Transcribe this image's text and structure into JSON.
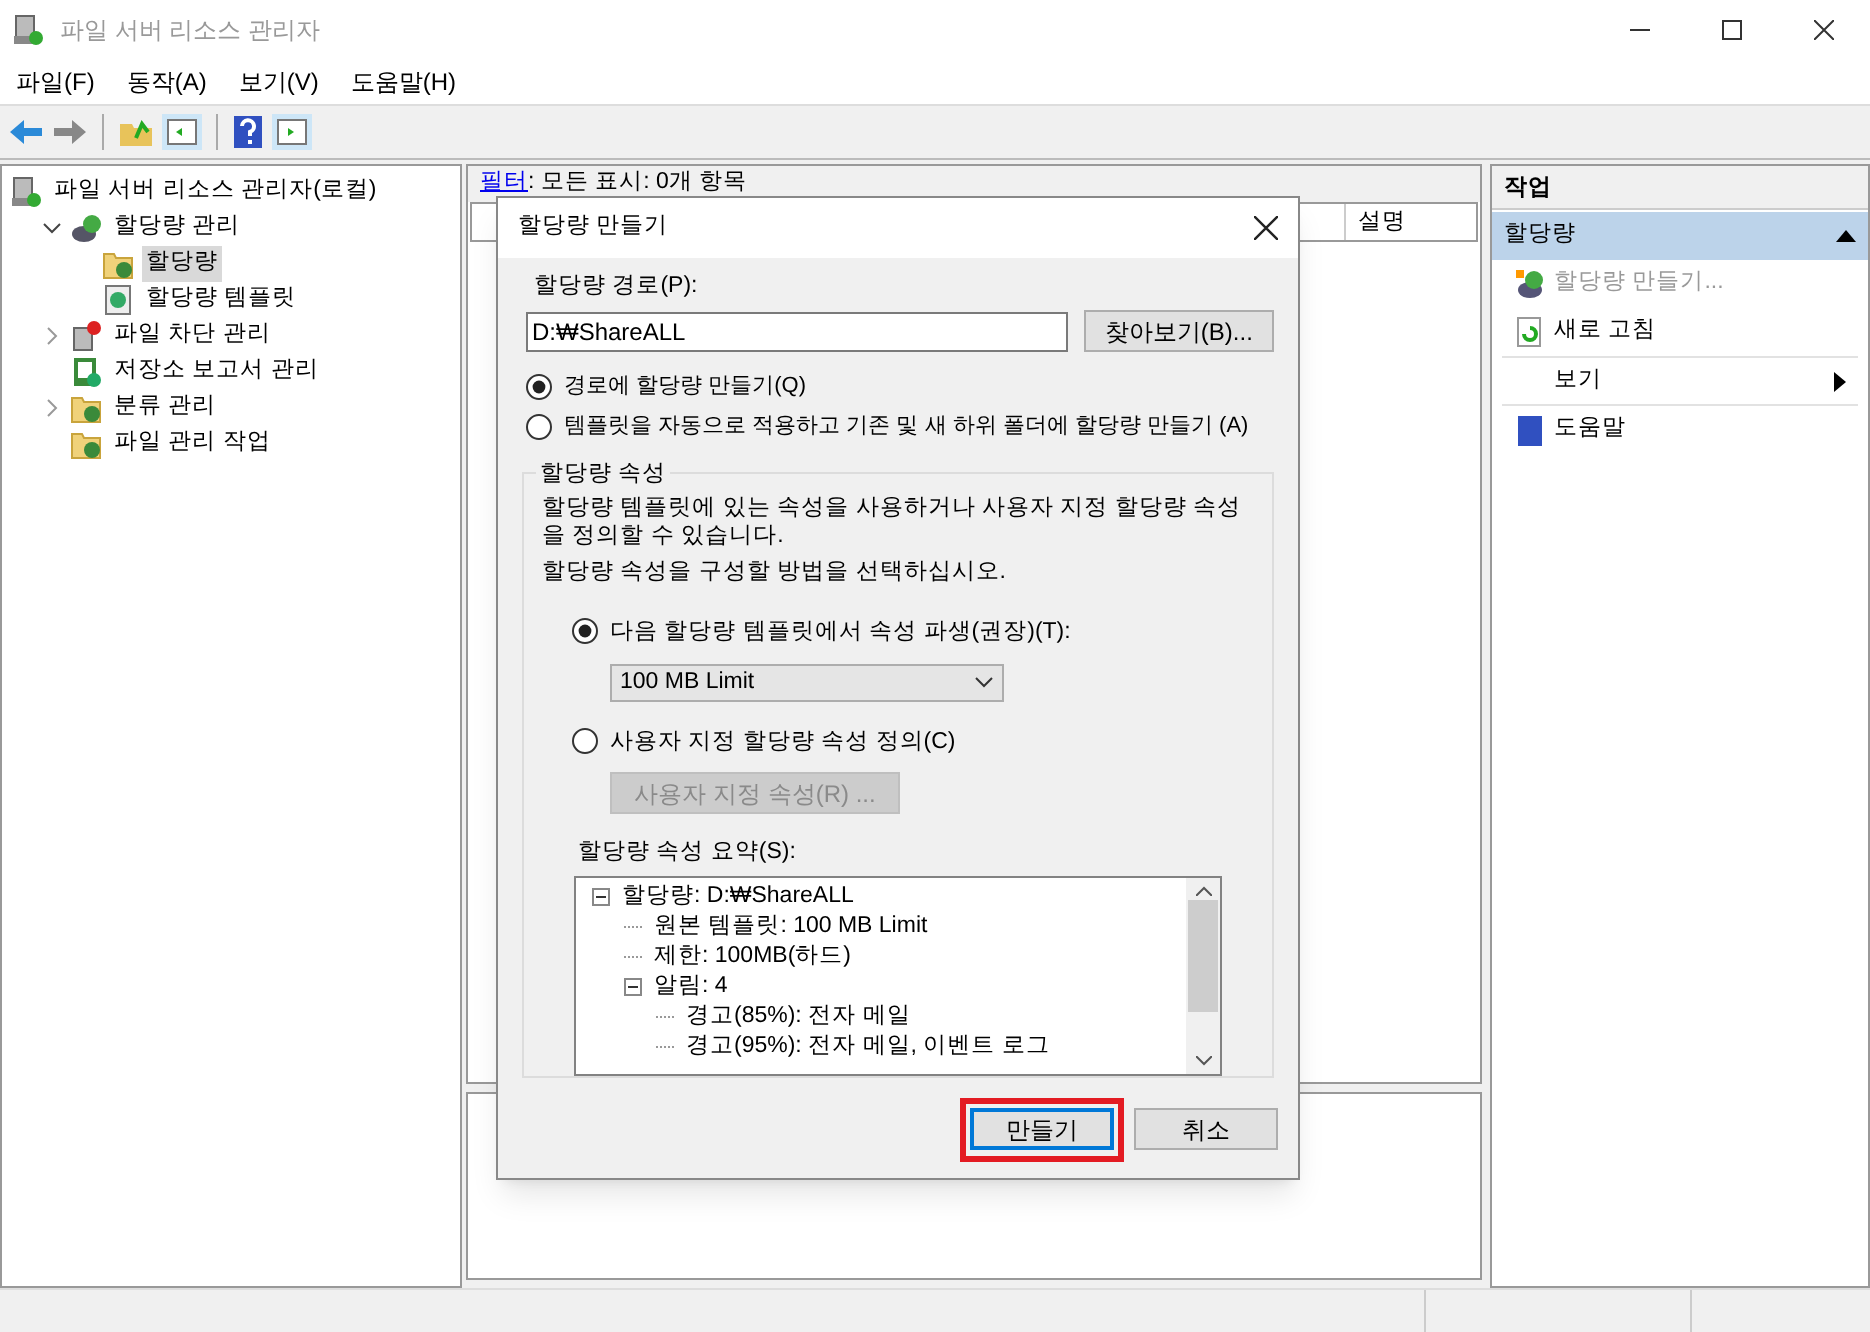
{
  "window": {
    "title": "파일 서버 리소스 관리자"
  },
  "menu": [
    "파일(F)",
    "동작(A)",
    "보기(V)",
    "도움말(H)"
  ],
  "tree": [
    {
      "label": "파일 서버 리소스 관리자(로컬)",
      "selected": false,
      "children": [
        {
          "label": "할당량 관리",
          "expanded": true,
          "selected": false,
          "children": [
            {
              "label": "할당량",
              "selected": true
            },
            {
              "label": "할당량 템플릿",
              "selected": false
            }
          ]
        },
        {
          "label": "파일 차단 관리",
          "expanded": false,
          "selected": false
        },
        {
          "label": "저장소 보고서 관리",
          "selected": false
        },
        {
          "label": "분류 관리",
          "expanded": false,
          "selected": false
        },
        {
          "label": "파일 관리 작업",
          "selected": false
        }
      ]
    }
  ],
  "center": {
    "filter_link": "필터",
    "filter_text": ": 모든 표시: 0개 항목",
    "columns": [
      "설명"
    ]
  },
  "actions": {
    "header": "작업",
    "section": "할당량",
    "items": [
      {
        "label": "할당량 만들기...",
        "kind": "action",
        "disabled": true
      },
      {
        "label": "새로 고침",
        "kind": "action",
        "disabled": false
      },
      {
        "label": "보기",
        "kind": "submenu",
        "disabled": false
      },
      {
        "label": "도움말",
        "kind": "action",
        "disabled": false
      }
    ]
  },
  "dialog": {
    "title": "할당량 만들기",
    "path_label": "할당량 경로(P):",
    "path_value": "D:₩ShareALL",
    "browse_button": "찾아보기(B)...",
    "modes": [
      {
        "label": "경로에 할당량 만들기(Q)",
        "selected": true
      },
      {
        "label": "템플릿을 자동으로 적용하고 기존 및 새 하위 폴더에 할당량 만들기 (A)",
        "selected": false
      }
    ],
    "group": {
      "title": "할당량 속성",
      "description": "할당량 템플릿에 있는 속성을 사용하거나 사용자 지정 할당량 속성을 정의할 수 있습니다.",
      "instruction": "할당량 속성을 구성할 방법을 선택하십시오.",
      "options": [
        {
          "label": "다음 할당량 템플릿에서 속성 파생(권장)(T):",
          "selected": true,
          "kind": "select",
          "value": "100 MB Limit"
        },
        {
          "label": "사용자 지정 할당량 속성 정의(C)",
          "selected": false,
          "kind": "button",
          "button": "사용자 지정 속성(R) ...",
          "disabled": true
        }
      ],
      "summary_label": "할당량 속성 요약(S):",
      "summary": [
        {
          "label": "할당량: D:₩ShareALL",
          "expanded": true,
          "children": [
            {
              "label": "원본 템플릿: 100 MB Limit"
            },
            {
              "label": "제한: 100MB(하드)"
            },
            {
              "label": "알림: 4",
              "expanded": true,
              "children": [
                {
                  "label": "경고(85%): 전자 메일"
                },
                {
                  "label": "경고(95%): 전자 메일, 이벤트 로그"
                }
              ]
            }
          ]
        }
      ]
    },
    "buttons": [
      {
        "label": "만들기",
        "default": true,
        "highlighted": true
      },
      {
        "label": "취소",
        "default": false,
        "highlighted": false
      }
    ]
  }
}
